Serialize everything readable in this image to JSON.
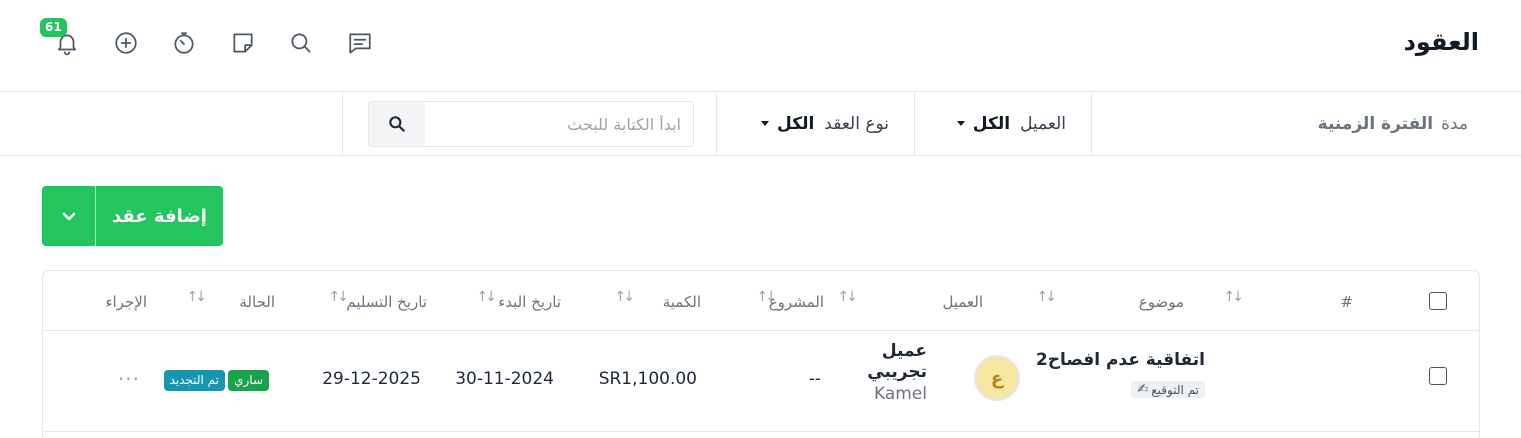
{
  "header": {
    "title": "العقود",
    "notification_count": "61",
    "icons": [
      "bell-icon",
      "plus-circle-icon",
      "timer-icon",
      "sticky-note-icon",
      "search-icon",
      "chat-icon"
    ]
  },
  "filters": {
    "period_label": "مدة",
    "period_value": "الفترة الزمنية",
    "client_label": "العميل",
    "client_value": "الكل",
    "type_label": "نوع العقد",
    "type_value": "الكل",
    "search_placeholder": "ابدأ الكتابة للبحث"
  },
  "actions": {
    "add_label": "إضافة عقد"
  },
  "table": {
    "columns": {
      "number": "#",
      "subject": "موضوع",
      "client": "العميل",
      "project": "المشروع",
      "amount": "الكمية",
      "start_date": "تاريخ البدء",
      "delivery_date": "تاريخ التسليم",
      "status": "الحالة",
      "action": "الإجراء"
    },
    "rows": [
      {
        "subject": "اتفاقية عدم افصاح2",
        "signed_label": "تم التوقيع",
        "avatar_letter": "ع",
        "client_name_line1": "عميل",
        "client_name_line2": "تجريبي",
        "client_sub": "Kamel",
        "project": "--",
        "amount": "SR1,100.00",
        "start_date": "30-11-2024",
        "delivery_date": "29-12-2025",
        "status_active": "ساري",
        "status_renewed": "تم التجديد",
        "action": "..."
      }
    ]
  },
  "colors": {
    "primary_green": "#22c55e",
    "status_active": "#16a34a",
    "status_renewed": "#1796b0",
    "avatar_bg": "#f5e7a1"
  }
}
